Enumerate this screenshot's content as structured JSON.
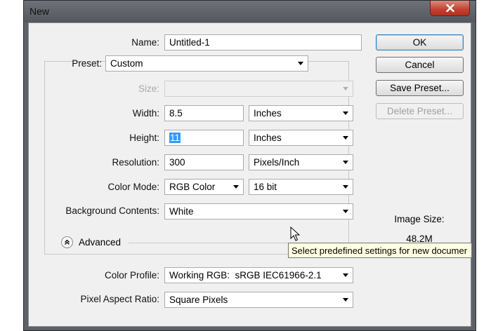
{
  "window": {
    "title": "New",
    "close_icon": "close-icon"
  },
  "form": {
    "name_label": "Name:",
    "name_value": "Untitled-1",
    "preset_label": "Preset:",
    "preset_value": "Custom",
    "size_label": "Size:",
    "size_value": "",
    "width_label": "Width:",
    "width_value": "8.5",
    "width_unit": "Inches",
    "height_label": "Height:",
    "height_value": "11",
    "height_unit": "Inches",
    "resolution_label": "Resolution:",
    "resolution_value": "300",
    "resolution_unit": "Pixels/Inch",
    "color_mode_label": "Color Mode:",
    "color_mode_value": "RGB Color",
    "bit_depth_value": "16 bit",
    "background_label": "Background Contents:",
    "background_value": "White",
    "advanced_label": "Advanced",
    "color_profile_label": "Color Profile:",
    "color_profile_value": "Working RGB:  sRGB IEC61966-2.1",
    "pixel_aspect_label": "Pixel Aspect Ratio:",
    "pixel_aspect_value": "Square Pixels"
  },
  "buttons": {
    "ok": "OK",
    "cancel": "Cancel",
    "save_preset": "Save Preset...",
    "delete_preset": "Delete Preset..."
  },
  "image_size": {
    "label": "Image Size:",
    "value": "48.2M"
  },
  "tooltip": "Select predefined settings for new documer"
}
